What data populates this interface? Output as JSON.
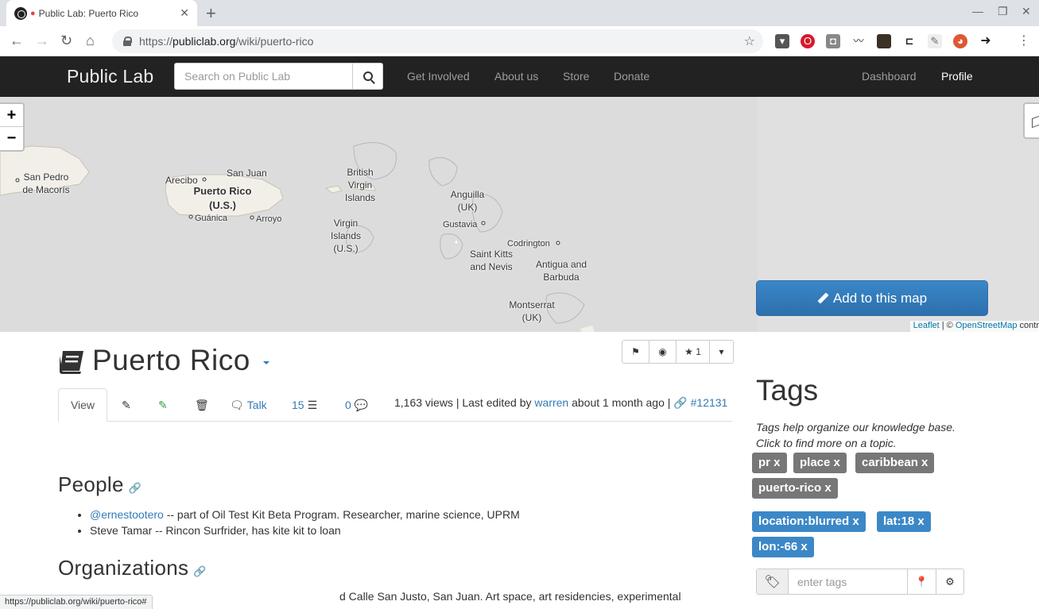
{
  "browser": {
    "tab_title": "Public Lab: Puerto Rico",
    "url_scheme": "https://",
    "url_host": "publiclab.org",
    "url_path": "/wiki/puerto-rico",
    "status_url": "https://publiclab.org/wiki/puerto-rico#"
  },
  "navbar": {
    "brand": "Public Lab",
    "search_placeholder": "Search on Public Lab",
    "links": [
      "Get Involved",
      "About us",
      "Store",
      "Donate"
    ],
    "dashboard": "Dashboard",
    "profile": "Profile"
  },
  "map": {
    "zoom_in": "+",
    "zoom_out": "−",
    "labels": {
      "san_pedro": "San Pedro de Macorís",
      "arecibo": "Arecibo",
      "san_juan": "San Juan",
      "puerto_rico": "Puerto Rico (U.S.)",
      "guanica": "Guánica",
      "arroyo": "Arroyo",
      "bvi": "British Virgin Islands",
      "usvi": "Virgin Islands (U.S.)",
      "anguilla": "Anguilla (UK)",
      "gustavia": "Gustavia",
      "codrington": "Codrington",
      "st_kitts": "Saint Kitts and Nevis",
      "antigua": "Antigua and Barbuda",
      "montserrat": "Montserrat (UK)"
    },
    "attribution_leaflet": "Leaflet",
    "attribution_sep": " | © ",
    "attribution_osm": "OpenStreetMap",
    "attribution_rest": " contr",
    "add_button": "Add to this map"
  },
  "page": {
    "title": "Puerto Rico",
    "star_count": "1",
    "tabs": {
      "view": "View",
      "talk": "Talk",
      "revisions": "15",
      "comments": "0"
    },
    "meta_views": "1,163 views | Last edited by ",
    "meta_author": "warren",
    "meta_time": " about 1 month ago | ",
    "meta_id": "#12131",
    "people_heading": "People",
    "people": [
      {
        "link": "@ernestootero",
        "text": " -- part of Oil Test Kit Beta Program. Researcher, marine science, UPRM"
      },
      {
        "link": "",
        "text": "Steve Tamar -- Rincon Surfrider, has kite kit to loan"
      }
    ],
    "orgs_heading": "Organizations",
    "org_line": "d Calle San Justo, San Juan. Art space, art residencies, experimental"
  },
  "sidebar": {
    "heading": "Tags",
    "help": "Tags help organize our knowledge base. Click to find more on a topic.",
    "tags": [
      "pr x",
      "place x",
      "caribbean x",
      "puerto-rico x"
    ],
    "power_tags": [
      "location:blurred x",
      "lat:18 x",
      "lon:-66 x"
    ],
    "tag_placeholder": "enter tags"
  }
}
